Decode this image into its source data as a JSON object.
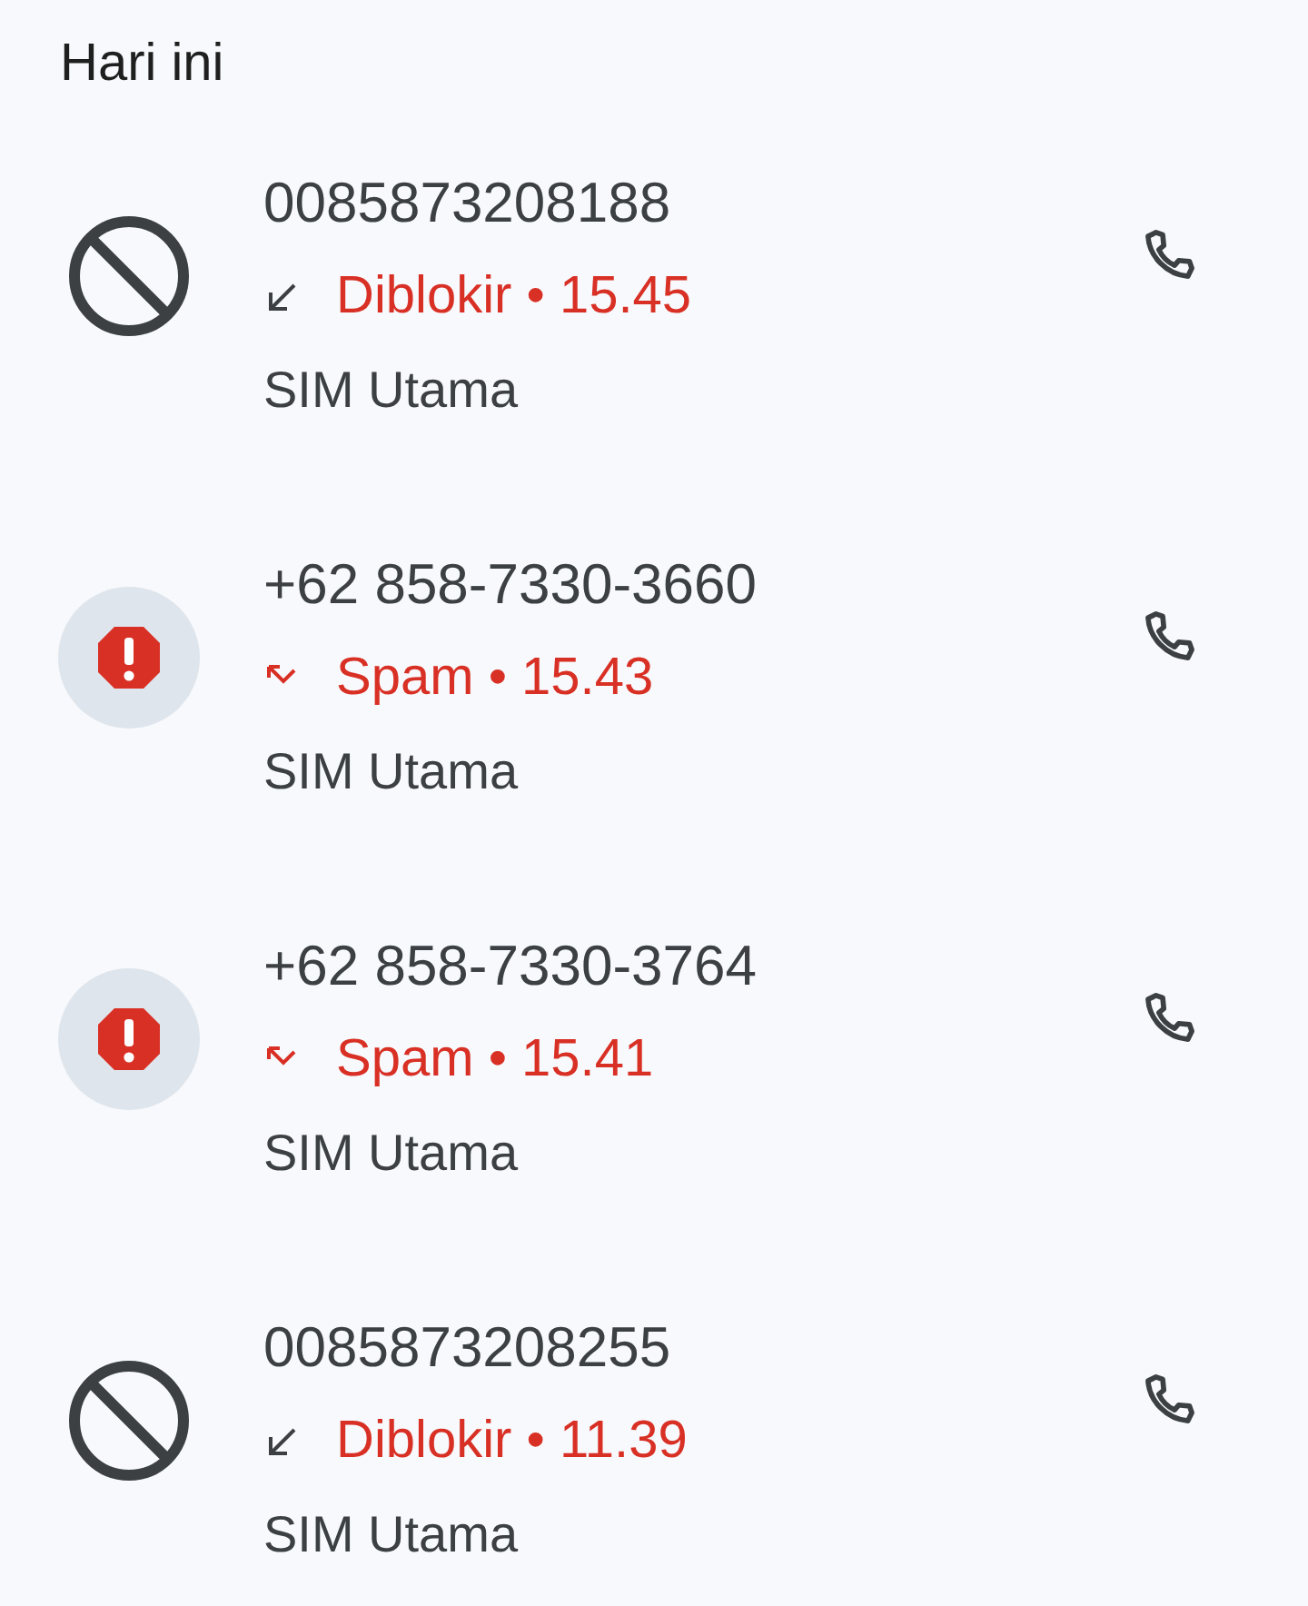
{
  "header": "Hari ini",
  "calls": [
    {
      "kind": "blocked",
      "number": "0085873208188",
      "status": "Diblokir • 15.45",
      "sim": "SIM Utama"
    },
    {
      "kind": "spam",
      "number": "+62 858-7330-3660",
      "status": "Spam • 15.43",
      "sim": "SIM Utama"
    },
    {
      "kind": "spam",
      "number": "+62 858-7330-3764",
      "status": "Spam • 15.41",
      "sim": "SIM Utama"
    },
    {
      "kind": "blocked",
      "number": "0085873208255",
      "status": "Diblokir • 11.39",
      "sim": "SIM Utama"
    }
  ]
}
